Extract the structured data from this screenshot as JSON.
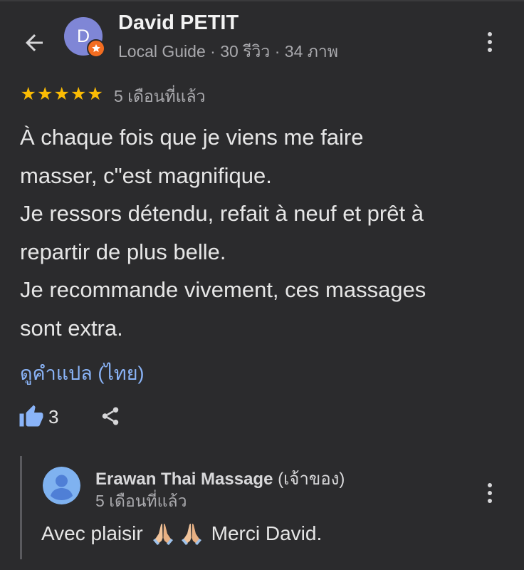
{
  "header": {
    "back_icon": "arrow-left-icon",
    "more_icon": "more-vert-icon"
  },
  "reviewer": {
    "avatar_letter": "D",
    "avatar_color": "#7f86d6",
    "badge_icon": "local-guide-star-icon",
    "badge_color": "#f36d21",
    "name": "David PETIT",
    "meta": "Local Guide · 30 รีวิว · 34 ภาพ"
  },
  "review": {
    "rating": 5,
    "rating_max": 5,
    "star_color": "#fbbc04",
    "time": "5 เดือนที่แล้ว",
    "lines": [
      "À chaque fois que je viens me faire",
      "masser, c\"est magnifique.",
      "Je ressors détendu, refait à neuf et prêt à",
      "repartir de plus belle.",
      "Je recommande vivement, ces massages",
      "sont extra."
    ],
    "translate_label": "ดูคำแปล (ไทย)",
    "translate_color": "#8ab4f8"
  },
  "actions": {
    "like_icon": "thumbs-up-icon",
    "like_count": "3",
    "like_color": "#8ab4f8",
    "share_icon": "share-icon"
  },
  "owner_reply": {
    "avatar_icon": "person-icon",
    "avatar_color": "#7fb2f0",
    "name": "Erawan Thai Massage",
    "role": "(เจ้าของ)",
    "time": "5 เดือนที่แล้ว",
    "text_before": "Avec plaisir",
    "emoji_icon": "folded-hands-icon",
    "emoji_count": 2,
    "text_after": "Merci David.",
    "more_icon": "more-vert-icon"
  }
}
